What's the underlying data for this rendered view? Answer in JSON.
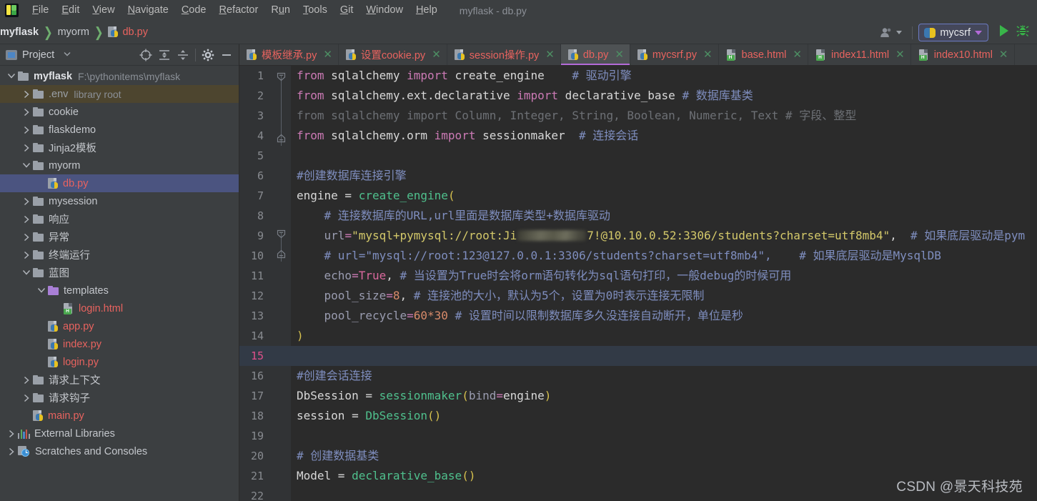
{
  "app": {
    "logo_icon": "pycharm-logo-icon",
    "window_title": "myflask - db.py"
  },
  "menubar": {
    "items": [
      {
        "label": "File",
        "mnemonic": "F"
      },
      {
        "label": "Edit",
        "mnemonic": "E"
      },
      {
        "label": "View",
        "mnemonic": "V"
      },
      {
        "label": "Navigate",
        "mnemonic": "N"
      },
      {
        "label": "Code",
        "mnemonic": "C"
      },
      {
        "label": "Refactor",
        "mnemonic": "R"
      },
      {
        "label": "Run",
        "mnemonic": "u"
      },
      {
        "label": "Tools",
        "mnemonic": "T"
      },
      {
        "label": "Git",
        "mnemonic": "G"
      },
      {
        "label": "Window",
        "mnemonic": "W"
      },
      {
        "label": "Help",
        "mnemonic": "H"
      }
    ]
  },
  "breadcrumb": {
    "items": [
      "myflask",
      "myorm"
    ],
    "file": "db.py",
    "file_icon": "python-file-icon",
    "separator": "❯"
  },
  "navbar_right": {
    "people_icon": "people-icon",
    "run_config": {
      "icon": "python-logo-icon",
      "label": "mycsrf",
      "dropdown_icon": "chevron-down-icon"
    },
    "run_icon": "run-play-icon",
    "debug_icon": "debug-bug-icon"
  },
  "project_panel": {
    "title": "Project",
    "title_icon": "project-window-icon",
    "caret_icon": "chevron-down-icon",
    "tools": [
      {
        "name": "locate-target-icon"
      },
      {
        "name": "expand-all-icon"
      },
      {
        "name": "collapse-all-icon"
      },
      {
        "name": "settings-gear-icon"
      },
      {
        "name": "hide-panel-icon"
      }
    ],
    "tree": [
      {
        "indent": 0,
        "arrow": "down",
        "icon": "folder",
        "label": "myflask",
        "bold": true,
        "sub": "F:\\pythonitems\\myflask"
      },
      {
        "indent": 1,
        "arrow": "right",
        "icon": "folder",
        "label": ".env",
        "sub": "library root",
        "muted": true,
        "row_highlight": "env"
      },
      {
        "indent": 1,
        "arrow": "right",
        "icon": "folder",
        "label": "cookie"
      },
      {
        "indent": 1,
        "arrow": "right",
        "icon": "folder",
        "label": "flaskdemo"
      },
      {
        "indent": 1,
        "arrow": "right",
        "icon": "folder",
        "label": "Jinja2模板"
      },
      {
        "indent": 1,
        "arrow": "down",
        "icon": "folder",
        "label": "myorm"
      },
      {
        "indent": 2,
        "arrow": "none",
        "icon": "python",
        "label": "db.py",
        "red": true,
        "selected": true
      },
      {
        "indent": 1,
        "arrow": "right",
        "icon": "folder",
        "label": "mysession"
      },
      {
        "indent": 1,
        "arrow": "right",
        "icon": "folder",
        "label": "响应"
      },
      {
        "indent": 1,
        "arrow": "right",
        "icon": "folder",
        "label": "异常"
      },
      {
        "indent": 1,
        "arrow": "right",
        "icon": "folder",
        "label": "终端运行"
      },
      {
        "indent": 1,
        "arrow": "down",
        "icon": "folder",
        "label": "蓝图"
      },
      {
        "indent": 2,
        "arrow": "down",
        "icon": "folder-purple",
        "label": "templates"
      },
      {
        "indent": 3,
        "arrow": "none",
        "icon": "html",
        "label": "login.html",
        "red": true
      },
      {
        "indent": 2,
        "arrow": "none",
        "icon": "python",
        "label": "app.py",
        "red": true
      },
      {
        "indent": 2,
        "arrow": "none",
        "icon": "python",
        "label": "index.py",
        "red": true
      },
      {
        "indent": 2,
        "arrow": "none",
        "icon": "python",
        "label": "login.py",
        "red": true
      },
      {
        "indent": 1,
        "arrow": "right",
        "icon": "folder",
        "label": "请求上下文"
      },
      {
        "indent": 1,
        "arrow": "right",
        "icon": "folder",
        "label": "请求钩子"
      },
      {
        "indent": 1,
        "arrow": "none",
        "icon": "python",
        "label": "main.py",
        "red": true
      },
      {
        "indent": 0,
        "arrow": "right",
        "icon": "library",
        "label": "External Libraries"
      },
      {
        "indent": 0,
        "arrow": "right",
        "icon": "scratch",
        "label": "Scratches and Consoles"
      }
    ]
  },
  "editor_tabs": [
    {
      "label": "模板继承.py",
      "icon": "python-file-icon",
      "active": false,
      "close_icon": "close-icon"
    },
    {
      "label": "设置cookie.py",
      "icon": "python-file-icon",
      "active": false,
      "close_icon": "close-icon"
    },
    {
      "label": "session操作.py",
      "icon": "python-file-icon",
      "active": false,
      "close_icon": "close-icon"
    },
    {
      "label": "db.py",
      "icon": "python-file-icon",
      "active": true,
      "close_icon": "close-icon"
    },
    {
      "label": "mycsrf.py",
      "icon": "python-file-icon",
      "active": false,
      "close_icon": "close-icon"
    },
    {
      "label": "base.html",
      "icon": "html-file-icon",
      "active": false,
      "close_icon": "close-icon"
    },
    {
      "label": "index11.html",
      "icon": "html-file-icon",
      "active": false,
      "close_icon": "close-icon"
    },
    {
      "label": "index10.html",
      "icon": "html-file-icon",
      "active": false,
      "close_icon": "close-icon"
    }
  ],
  "editor": {
    "current_line": 15,
    "line_count": 22,
    "line_numbers": [
      "1",
      "2",
      "3",
      "4",
      "5",
      "6",
      "7",
      "8",
      "9",
      "10",
      "11",
      "12",
      "13",
      "14",
      "15",
      "16",
      "17",
      "18",
      "19",
      "20",
      "21",
      "22"
    ],
    "code_lines": [
      "from sqlalchemy import create_engine    # 驱动引擎",
      "from sqlalchemy.ext.declarative import declarative_base # 数据库基类",
      "from sqlalchemy import Column, Integer, String, Boolean, Numeric, Text # 字段、整型",
      "from sqlalchemy.orm import sessionmaker  # 连接会话",
      "",
      "#创建数据库连接引擎",
      "engine = create_engine(",
      "    # 连接数据库的URL,url里面是数据库类型+数据库驱动",
      "    url=\"mysql+pymysql://root:Ji████7!@10.10.0.52:3306/students?charset=utf8mb4\",  # 如果底层驱动是pym",
      "    # url=\"mysql://root:123@127.0.0.1:3306/students?charset=utf8mb4\",    # 如果底层驱动是MysqlDB",
      "    echo=True, # 当设置为True时会将orm语句转化为sql语句打印，一般debug的时候可用",
      "    pool_size=8, # 连接池的大小，默认为5个，设置为0时表示连接无限制",
      "    pool_recycle=60*30 # 设置时间以限制数据库多久没连接自动断开，单位是秒",
      ")",
      "",
      "#创建会话连接",
      "DbSession = sessionmaker(bind=engine)",
      "session = DbSession()",
      "",
      "# 创建数据基类",
      "Model = declarative_base()",
      ""
    ],
    "tokens": {
      "keyword_from": "from",
      "keyword_import": "import",
      "module_1": "sqlalchemy",
      "module_2": "sqlalchemy.ext.declarative",
      "module_3": "sqlalchemy.orm",
      "name_create_engine": "create_engine",
      "name_declarative_base": "declarative_base",
      "name_sessionmaker": "sessionmaker",
      "comment_1": "# 驱动引擎",
      "comment_2": "# 数据库基类",
      "comment_3": "# 字段、整型",
      "comment_4": "# 连接会话",
      "comment_block_1": "#创建数据库连接引擎",
      "comment_url": "# 连接数据库的URL,url里面是数据库类型+数据库驱动",
      "comment_pymysql": "# 如果底层驱动是pym",
      "comment_mysqldb": "# 如果底层驱动是MysqlDB",
      "comment_echo": "# 当设置为True时会将orm语句转化为sql语句打印，一般debug的时候可用",
      "comment_pool_size": "# 连接池的大小，默认为5个，设置为0时表示连接无限制",
      "comment_pool_recycle": "# 设置时间以限制数据库多久没连接自动断开，单位是秒",
      "comment_block_2": "#创建会话连接",
      "comment_block_3": "# 创建数据基类",
      "dim_line3": "from sqlalchemy import Column, Integer, String, Boolean, Numeric, Text",
      "url_prefix": "\"mysql+pymysql://root:Ji",
      "url_suffix": "7!@10.10.0.52:3306/students?charset=utf8mb4\",",
      "commented_url": "# url=\"mysql://root:123@127.0.0.1:3306/students?charset=utf8mb4\",",
      "engine_name": "engine",
      "url_kwarg": "url",
      "echo_kwarg": "echo",
      "echo_value": "True",
      "pool_size_kwarg": "pool_size",
      "pool_size_value": "8",
      "pool_recycle_kwarg": "pool_recycle",
      "pool_recycle_value": "60*30",
      "dbsession_name": "DbSession",
      "bind_kwarg": "bind",
      "session_name": "session",
      "model_name": "Model"
    }
  },
  "watermark": "CSDN @景天科技苑",
  "colors": {
    "bg_editor": "#2b2b2b",
    "bg_panel": "#3c3f41",
    "accent_tab": "#b36ad8",
    "selection": "#4b5480",
    "file_red": "#e8635f",
    "comment_blue": "#7f8ebf",
    "string_yellow": "#d4c96a",
    "function_green": "#4fc08d",
    "keyword_pink": "#cc7ab5",
    "run_green": "#4caf50"
  }
}
